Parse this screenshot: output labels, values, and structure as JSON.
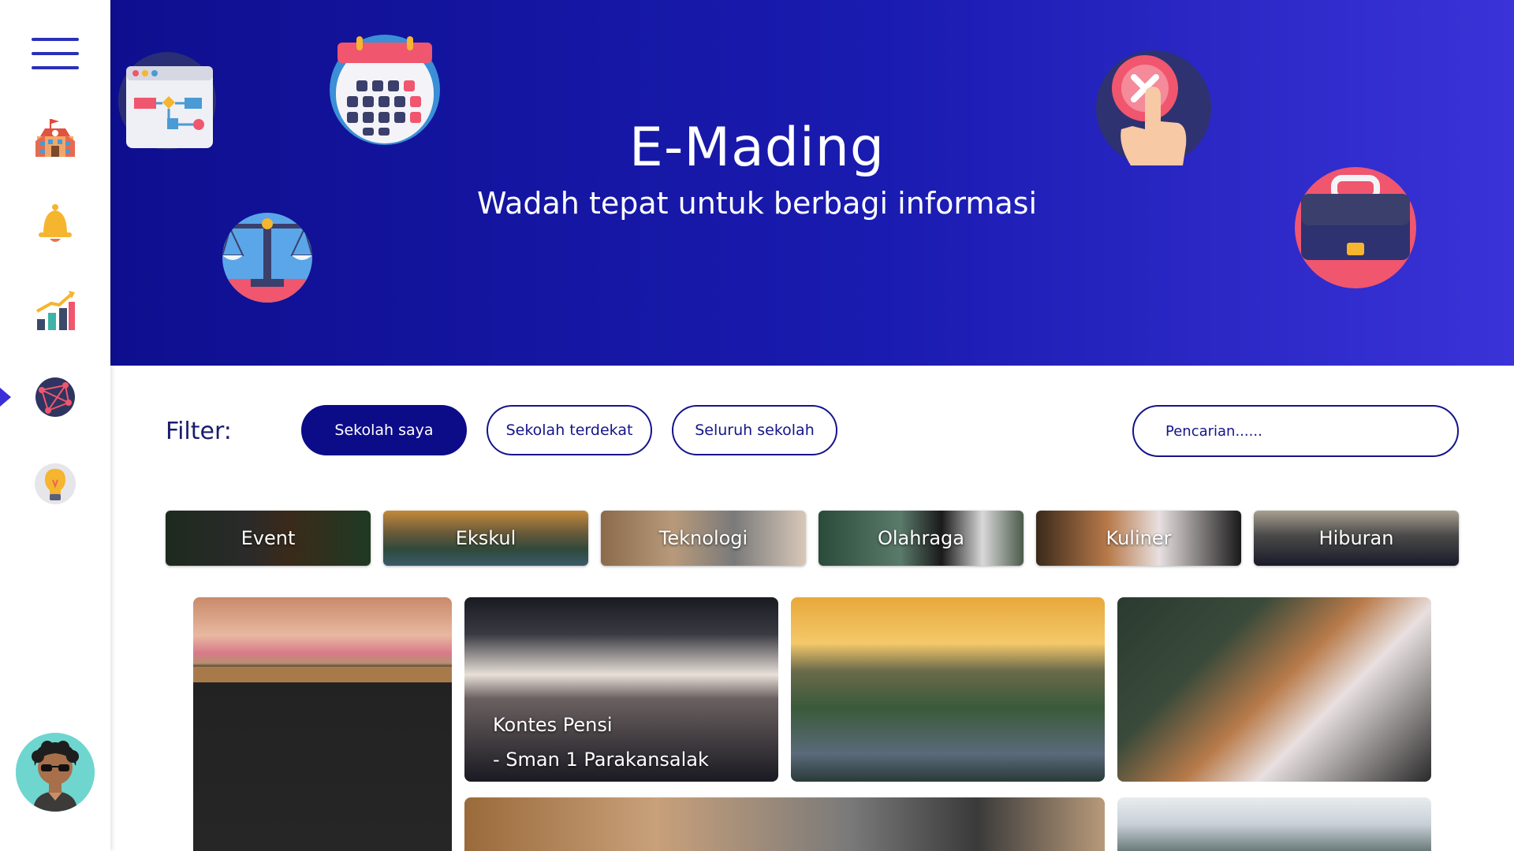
{
  "hero": {
    "title": "E-Mading",
    "subtitle": "Wadah tepat untuk berbagi informasi"
  },
  "sidebar": {
    "items": [
      {
        "icon": "school-icon"
      },
      {
        "icon": "bell-icon"
      },
      {
        "icon": "chart-icon"
      },
      {
        "icon": "network-icon",
        "active": true
      },
      {
        "icon": "lightbulb-icon"
      }
    ]
  },
  "filter": {
    "label": "Filter:",
    "options": [
      "Sekolah saya",
      "Sekolah terdekat",
      "Seluruh sekolah"
    ],
    "selected": "Sekolah saya",
    "search_placeholder": "Pencarian......"
  },
  "categories": [
    "Event",
    "Ekskul",
    "Teknologi",
    "Olahraga",
    "Kuliner",
    "Hiburan"
  ],
  "posts": [
    {
      "title_line1": "Kontes Pensi",
      "title_line2": "- Sman 1 Parakansalak"
    }
  ],
  "colors": {
    "primary": "#0c0c88",
    "hero_start": "#0e0f8f",
    "hero_end": "#3a33d8",
    "accent": "#3b2fd8"
  }
}
